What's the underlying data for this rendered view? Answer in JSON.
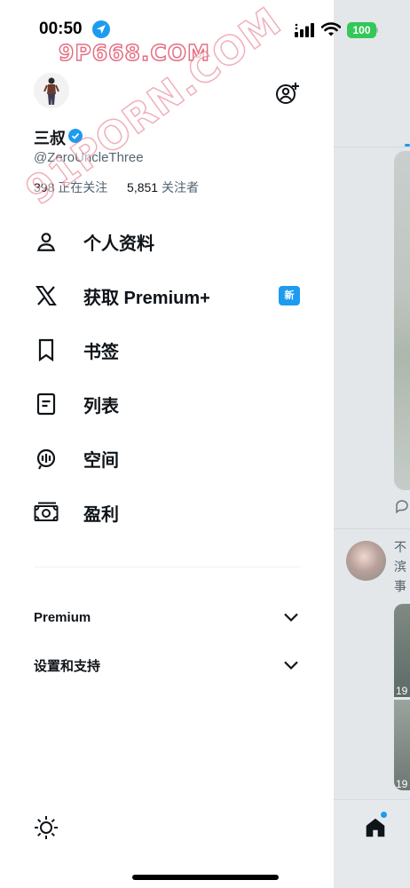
{
  "status_bar": {
    "time": "00:50",
    "battery": "100"
  },
  "watermarks": {
    "top": "9P668.COM",
    "diagonal": "91PORN.COM"
  },
  "profile": {
    "name": "三叔",
    "handle": "@ZeroUncleThree",
    "following_count": "398",
    "following_label": "正在关注",
    "followers_count": "5,851",
    "followers_label": "关注者"
  },
  "menu": [
    {
      "label": "个人资料",
      "icon": "person-icon"
    },
    {
      "label": "获取 Premium+",
      "icon": "x-logo-icon",
      "badge": "新"
    },
    {
      "label": "书签",
      "icon": "bookmark-icon"
    },
    {
      "label": "列表",
      "icon": "list-icon"
    },
    {
      "label": "空间",
      "icon": "spaces-icon"
    },
    {
      "label": "盈利",
      "icon": "monetization-icon"
    }
  ],
  "sections": [
    {
      "label": "Premium"
    },
    {
      "label": "设置和支持"
    }
  ],
  "timeline_peek": {
    "line1": "不",
    "line2": "滨",
    "line3": "事",
    "media_num1": "19",
    "media_num2": "19"
  },
  "colors": {
    "accent": "#1d9bf0",
    "text": "#0f1419",
    "secondary_text": "#536471",
    "watermark": "#e46f83"
  }
}
